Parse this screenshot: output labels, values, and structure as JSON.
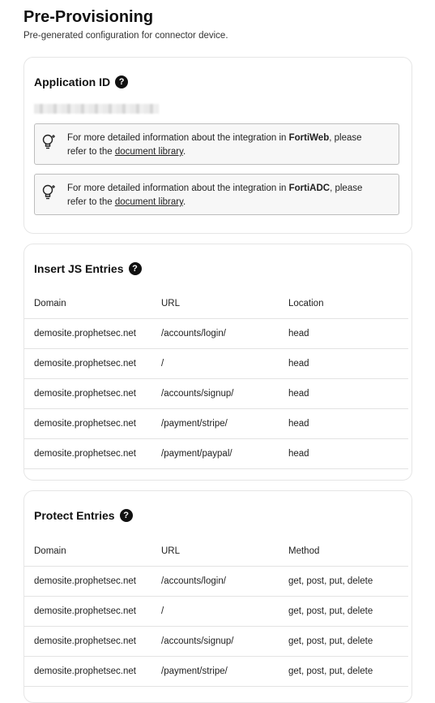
{
  "header": {
    "title": "Pre-Provisioning",
    "subtitle": "Pre-generated configuration for connector device."
  },
  "application_id": {
    "title": "Application ID",
    "help": "?",
    "info_boxes": [
      {
        "prefix": "For more detailed information about the integration in ",
        "product": "FortiWeb",
        "middle": ", please refer to the ",
        "link": "document library",
        "suffix": "."
      },
      {
        "prefix": "For more detailed information about the integration in ",
        "product": "FortiADC",
        "middle": ", please refer to the ",
        "link": "document library",
        "suffix": "."
      }
    ]
  },
  "insert_js": {
    "title": "Insert JS Entries",
    "help": "?",
    "columns": [
      "Domain",
      "URL",
      "Location"
    ],
    "rows": [
      [
        "demosite.prophetsec.net",
        "/accounts/login/",
        "head"
      ],
      [
        "demosite.prophetsec.net",
        "/",
        "head"
      ],
      [
        "demosite.prophetsec.net",
        "/accounts/signup/",
        "head"
      ],
      [
        "demosite.prophetsec.net",
        "/payment/stripe/",
        "head"
      ],
      [
        "demosite.prophetsec.net",
        "/payment/paypal/",
        "head"
      ]
    ]
  },
  "protect": {
    "title": "Protect Entries",
    "help": "?",
    "columns": [
      "Domain",
      "URL",
      "Method"
    ],
    "rows": [
      [
        "demosite.prophetsec.net",
        "/accounts/login/",
        "get, post, put, delete"
      ],
      [
        "demosite.prophetsec.net",
        "/",
        "get, post, put, delete"
      ],
      [
        "demosite.prophetsec.net",
        "/accounts/signup/",
        "get, post, put, delete"
      ],
      [
        "demosite.prophetsec.net",
        "/payment/stripe/",
        "get, post, put, delete"
      ]
    ]
  },
  "icons": {
    "help": "question-circle-icon",
    "info": "lightbulb-icon"
  }
}
